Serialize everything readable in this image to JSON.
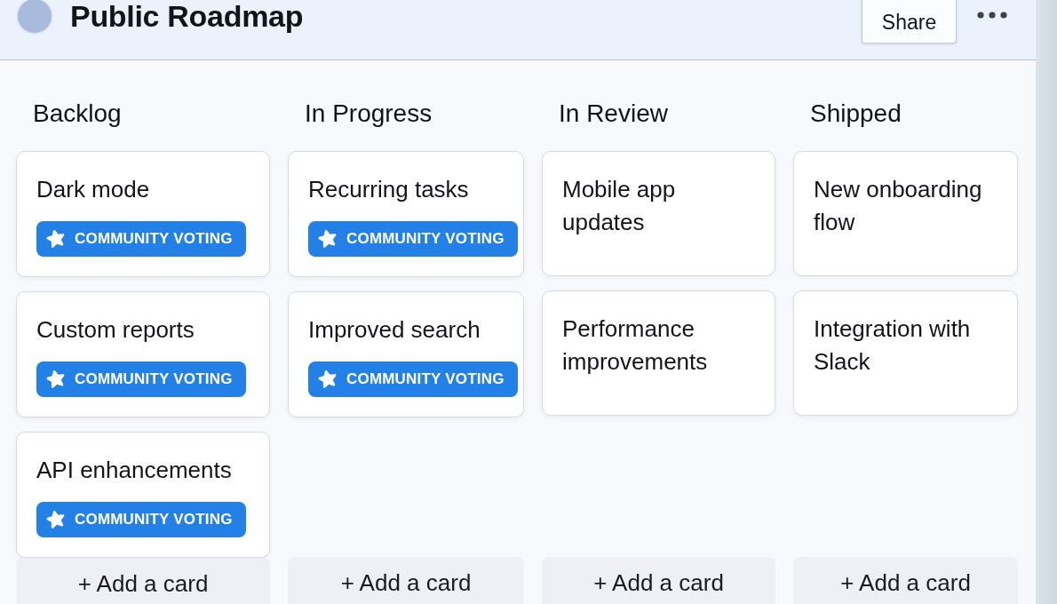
{
  "header": {
    "title": "Public Roadmap",
    "share_button": "Share"
  },
  "columns": [
    {
      "title": "Backlog",
      "cards": [
        {
          "title": "Dark mode",
          "badge": "COMMUNITY VOTING"
        },
        {
          "title": "Custom reports",
          "badge": "COMMUNITY VOTING"
        },
        {
          "title": "API enhancements",
          "badge": "COMMUNITY VOTING"
        }
      ],
      "add_button": "+ Add a card"
    },
    {
      "title": "In Progress",
      "cards": [
        {
          "title": "Recurring tasks",
          "badge": "COMMUNITY VOTING"
        },
        {
          "title": "Improved search",
          "badge": "COMMUNITY VOTING"
        }
      ],
      "add_button": "+ Add a card"
    },
    {
      "title": "In Review",
      "cards": [
        {
          "title": "Mobile app updates"
        },
        {
          "title": "Performance improvements"
        }
      ],
      "add_button": "+ Add a card"
    },
    {
      "title": "Shipped",
      "cards": [
        {
          "title": "New onboarding flow"
        },
        {
          "title": "Integration with Slack"
        }
      ],
      "add_button": "+ Add a card"
    }
  ]
}
